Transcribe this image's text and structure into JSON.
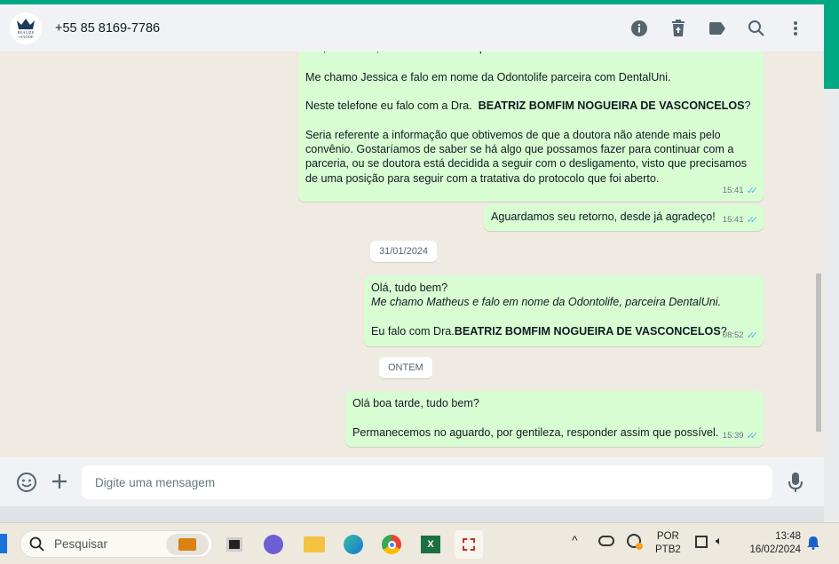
{
  "header": {
    "contact": "+55 85 8169-7786",
    "avatar_text": "REALIZE +SAÚDE",
    "icons": [
      "info-icon",
      "trash-icon",
      "label-icon",
      "search-icon",
      "more-vert-icon"
    ]
  },
  "messages": [
    {
      "paragraphs": [
        "Olá, boa tarde, tudo bem? Estimo que sim.",
        "Me chamo Jessica e falo em nome da Odontolife parceira com DentalUni."
      ],
      "p3_pre": "Neste telefone eu falo com a Dra.  ",
      "p3_bold": "BEATRIZ BOMFIM NOGUEIRA DE VASCONCELOS",
      "p3_post": "?",
      "p4": "Seria referente a informação que obtivemos de que a doutora não atende mais pelo convênio. Gostaríamos de saber se há algo que possamos fazer para continuar com a parceria, ou se doutora está decidida a seguir com o desligamento, visto que precisamos de uma posição para seguir com a tratativa do protocolo que foi aberto.",
      "time": "15:41"
    },
    {
      "text": "Aguardamos seu retorno, desde já agradeço!",
      "time": "15:41"
    },
    {
      "line1": "Olá, tudo bem?",
      "line2_italic": "Me chamo Matheus e falo em nome da Odontolife, parceira DentalUni.",
      "line3_pre": "Eu falo com Dra.",
      "line3_bold": "BEATRIZ BOMFIM NOGUEIRA DE VASCONCELOS",
      "line3_post": "?",
      "time": "08:52"
    },
    {
      "line1": "Olá boa tarde, tudo bem?",
      "line2": "Permanecemos no aguardo, por gentileza, responder assim que possível.",
      "time": "15:39"
    }
  ],
  "dates": [
    "31/01/2024",
    "ONTEM"
  ],
  "composer": {
    "placeholder": "Digite uma mensagem"
  },
  "taskbar": {
    "search_placeholder": "Pesquisar",
    "lang1": "POR",
    "lang2": "PTB2",
    "time": "13:48",
    "date": "16/02/2024"
  }
}
